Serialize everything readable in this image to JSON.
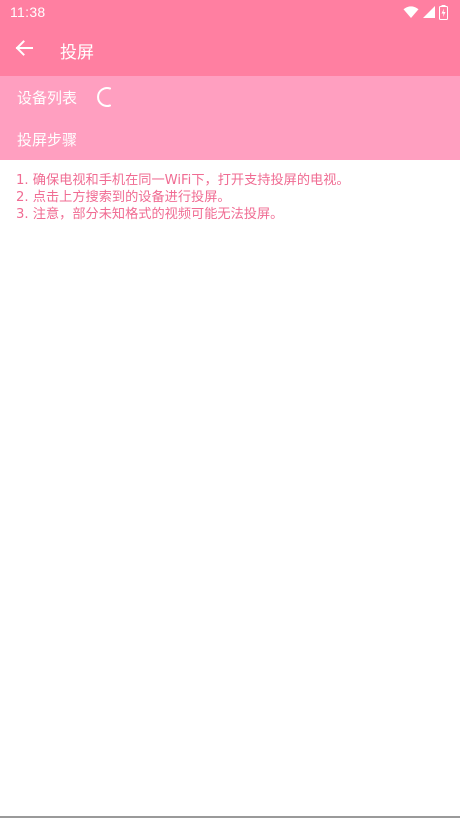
{
  "status_bar": {
    "time": "11:38",
    "icons": [
      "wifi-icon",
      "signal-icon",
      "battery-icon"
    ]
  },
  "app_bar": {
    "back_icon": "arrow-left-icon",
    "title": "投屏"
  },
  "sections": {
    "device_list_label": "设备列表",
    "steps_label": "投屏步骤"
  },
  "steps": [
    "1. 确保电视和手机在同一WiFi下，打开支持投屏的电视。",
    "2. 点击上方搜索到的设备进行投屏。",
    "3. 注意，部分未知格式的视频可能无法投屏。"
  ],
  "colors": {
    "primary": "#ff7fa1",
    "panel": "#ff9fc0",
    "step_text": "#f06c93"
  }
}
